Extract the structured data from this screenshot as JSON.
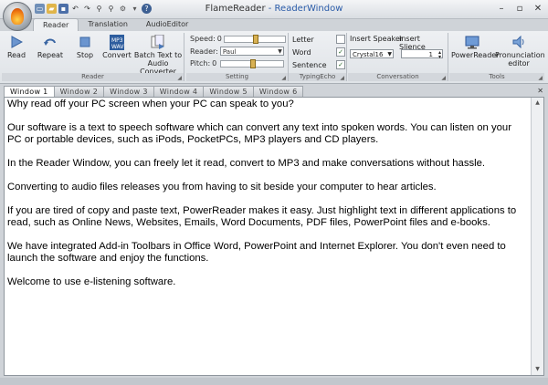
{
  "window": {
    "app_name": "FlameReader",
    "separator": " - ",
    "window_name": "ReaderWindow"
  },
  "ribbon_tabs": [
    "Reader",
    "Translation",
    "AudioEditor"
  ],
  "groups": {
    "reader": {
      "title": "Reader",
      "buttons": {
        "read": "Read",
        "repeat": "Repeat",
        "stop": "Stop",
        "convert": "Convert",
        "batch_line1": "Batch Text to",
        "batch_line2": "Audio Converter"
      }
    },
    "setting": {
      "title": "Setting",
      "speed_label": "Speed:",
      "speed_value": "0",
      "reader_label": "Reader:",
      "reader_value": "Paul",
      "pitch_label": "Pitch:",
      "pitch_value": "0"
    },
    "typing_echo": {
      "title": "TypingEcho",
      "options": [
        {
          "label": "Letter",
          "checked": false
        },
        {
          "label": "Word",
          "checked": true
        },
        {
          "label": "Sentence",
          "checked": true
        }
      ]
    },
    "conversation": {
      "title": "Conversation",
      "insert_speaker_label": "Insert Speaker",
      "speaker_value": "Crystal16",
      "insert_silence_label": "Insert Slience",
      "silence_value": "1"
    },
    "tools": {
      "title": "Tools",
      "power_reader": "PowerReader",
      "pron_line1": "Pronunciation",
      "pron_line2": "editor"
    }
  },
  "doc_tabs": [
    "Window  1",
    "Window  2",
    "Window  3",
    "Window  4",
    "Window  5",
    "Window  6"
  ],
  "document": {
    "paragraphs": [
      " Why read off your PC screen when your PC can speak to you?",
      "Our software  is a text to speech software which can convert any text into spoken words. You can listen on your PC or portable devices, such as iPods, PocketPCs, MP3 players and CD players.",
      "In the Reader Window, you can freely let it read, convert to MP3 and make conversations without hassle.",
      "Converting to audio files releases you from having to sit beside your computer to hear articles.",
      "If you are tired of copy and paste text, PowerReader makes it easy. Just highlight text in different applications to read, such as Online News, Websites,  Emails, Word Documents, PDF files, PowerPoint files and e-books.",
      "We have integrated Add-in Toolbars in Office Word, PowerPoint and Internet Explorer. You don't even need to launch the software and enjoy the functions.",
      "Welcome to use e-listening software."
    ]
  },
  "colors": {
    "title_accent": "#2a5ba8",
    "ribbon_bg": "#e6e9ed",
    "check_mark": "#2b6a2b"
  }
}
